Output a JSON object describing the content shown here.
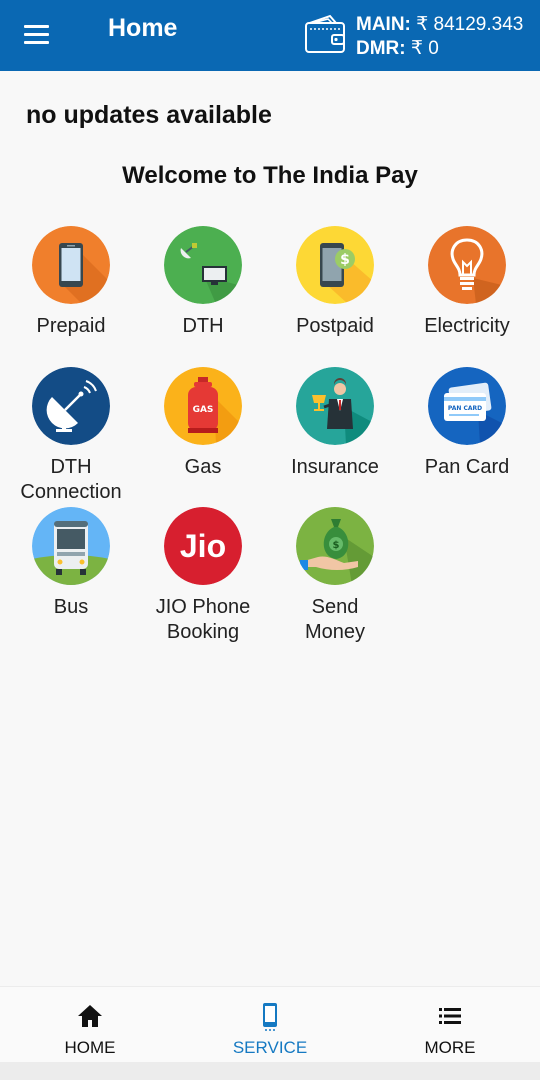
{
  "header": {
    "title": "Home",
    "main_label": "MAIN:",
    "main_value": "₹ 84129.343",
    "dmr_label": "DMR:",
    "dmr_value": "₹ 0"
  },
  "updates_text": "no updates available",
  "welcome_text": "Welcome to The India Pay",
  "services": [
    {
      "label": "Prepaid",
      "icon": "mobile-icon",
      "color": "#f07f2c"
    },
    {
      "label": "DTH",
      "icon": "satellite-tv-icon",
      "color": "#4caf50"
    },
    {
      "label": "Postpaid",
      "icon": "mobile-bill-icon",
      "color": "#fdd835"
    },
    {
      "label": "Electricity",
      "icon": "bulb-icon",
      "color": "#e8742b"
    },
    {
      "label": "DTH Connection",
      "icon": "satellite-dish-icon",
      "color": "#134c86"
    },
    {
      "label": "Gas",
      "icon": "gas-cylinder-icon",
      "color": "#fbb21a"
    },
    {
      "label": "Insurance",
      "icon": "insurance-icon",
      "color": "#26a59a"
    },
    {
      "label": "Pan Card",
      "icon": "pan-card-icon",
      "color": "#1565c0"
    },
    {
      "label": "Bus",
      "icon": "bus-icon",
      "color": "#64b5f6"
    },
    {
      "label": "JIO Phone Booking",
      "icon": "jio-icon",
      "color": "#d71f2f"
    },
    {
      "label": "Send Money",
      "icon": "money-bag-icon",
      "color": "#7cb342"
    }
  ],
  "jio_text": "Jio",
  "gas_text": "GAS",
  "pan_text": "PAN CARD",
  "bottom_nav": [
    {
      "label": "HOME",
      "icon": "home-icon",
      "active": false
    },
    {
      "label": "SERVICE",
      "icon": "phone-icon",
      "active": true
    },
    {
      "label": "MORE",
      "icon": "list-icon",
      "active": false
    }
  ],
  "colors": {
    "appbar": "#0a68b3",
    "accent": "#1579c2",
    "background": "#f8f8f8"
  }
}
